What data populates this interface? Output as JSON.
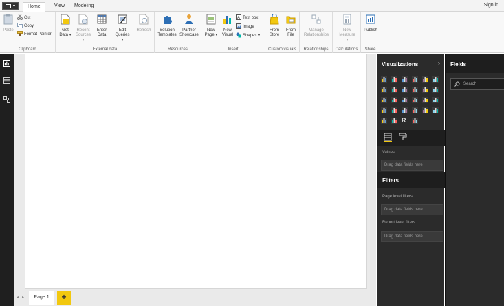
{
  "tabs": {
    "home": "Home",
    "view": "View",
    "modeling": "Modeling"
  },
  "signin": "Sign in",
  "ribbon": {
    "clipboard": {
      "label": "Clipboard",
      "paste": "Paste",
      "cut": "Cut",
      "copy": "Copy",
      "format_painter": "Format Painter"
    },
    "external_data": {
      "label": "External data",
      "get_data": [
        "Get",
        "Data ▾"
      ],
      "recent_sources": [
        "Recent",
        "Sources ▾"
      ],
      "enter_data": [
        "Enter",
        "Data"
      ],
      "edit_queries": [
        "Edit",
        "Queries ▾"
      ],
      "refresh": "Refresh"
    },
    "resources": {
      "label": "Resources",
      "solution_templates": [
        "Solution",
        "Templates"
      ],
      "partner_showcase": [
        "Partner",
        "Showcase"
      ]
    },
    "insert": {
      "label": "Insert",
      "new_page": [
        "New",
        "Page ▾"
      ],
      "new_visual": [
        "New",
        "Visual"
      ],
      "text_box": "Text box",
      "image": "Image",
      "shapes": "Shapes ▾"
    },
    "custom_visuals": {
      "label": "Custom visuals",
      "from_store": [
        "From",
        "Store"
      ],
      "from_file": [
        "From",
        "File"
      ]
    },
    "relationships": {
      "label": "Relationships",
      "manage": [
        "Manage",
        "Relationships"
      ]
    },
    "calculations": {
      "label": "Calculations",
      "new_measure": [
        "New",
        "Measure ▾"
      ]
    },
    "share": {
      "label": "Share",
      "publish": "Publish"
    }
  },
  "page_tab": "Page 1",
  "add_page": "+",
  "visualizations": {
    "title": "Visualizations",
    "values_label": "Values",
    "drag_here": "Drag data fields here",
    "more": "···"
  },
  "filters": {
    "title": "Filters",
    "page_level": "Page level filters",
    "report_level": "Report level filters",
    "drag_here": "Drag data fields here"
  },
  "fields": {
    "title": "Fields",
    "search_placeholder": "Search"
  },
  "colors": {
    "accent": "#f2c80f",
    "pane_dark": "#2b2b2b",
    "pane_header": "#1e1e1e",
    "nav": "#1f1f1f"
  }
}
